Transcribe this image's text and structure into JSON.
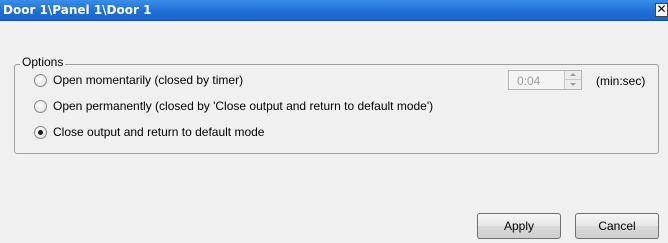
{
  "window": {
    "title": "Door 1\\Panel 1\\Door 1",
    "close_glyph": "✕"
  },
  "options": {
    "legend": "Options",
    "items": [
      {
        "label": "Open momentarily (closed by timer)",
        "checked": false
      },
      {
        "label": "Open permanently (closed by 'Close output and return to default mode')",
        "checked": false
      },
      {
        "label": "Close output and return to default mode",
        "checked": true
      }
    ],
    "timer": {
      "value": "0:04",
      "unit": "(min:sec)",
      "enabled": false
    }
  },
  "buttons": {
    "apply_label": "Apply",
    "cancel_label": "Cancel"
  }
}
